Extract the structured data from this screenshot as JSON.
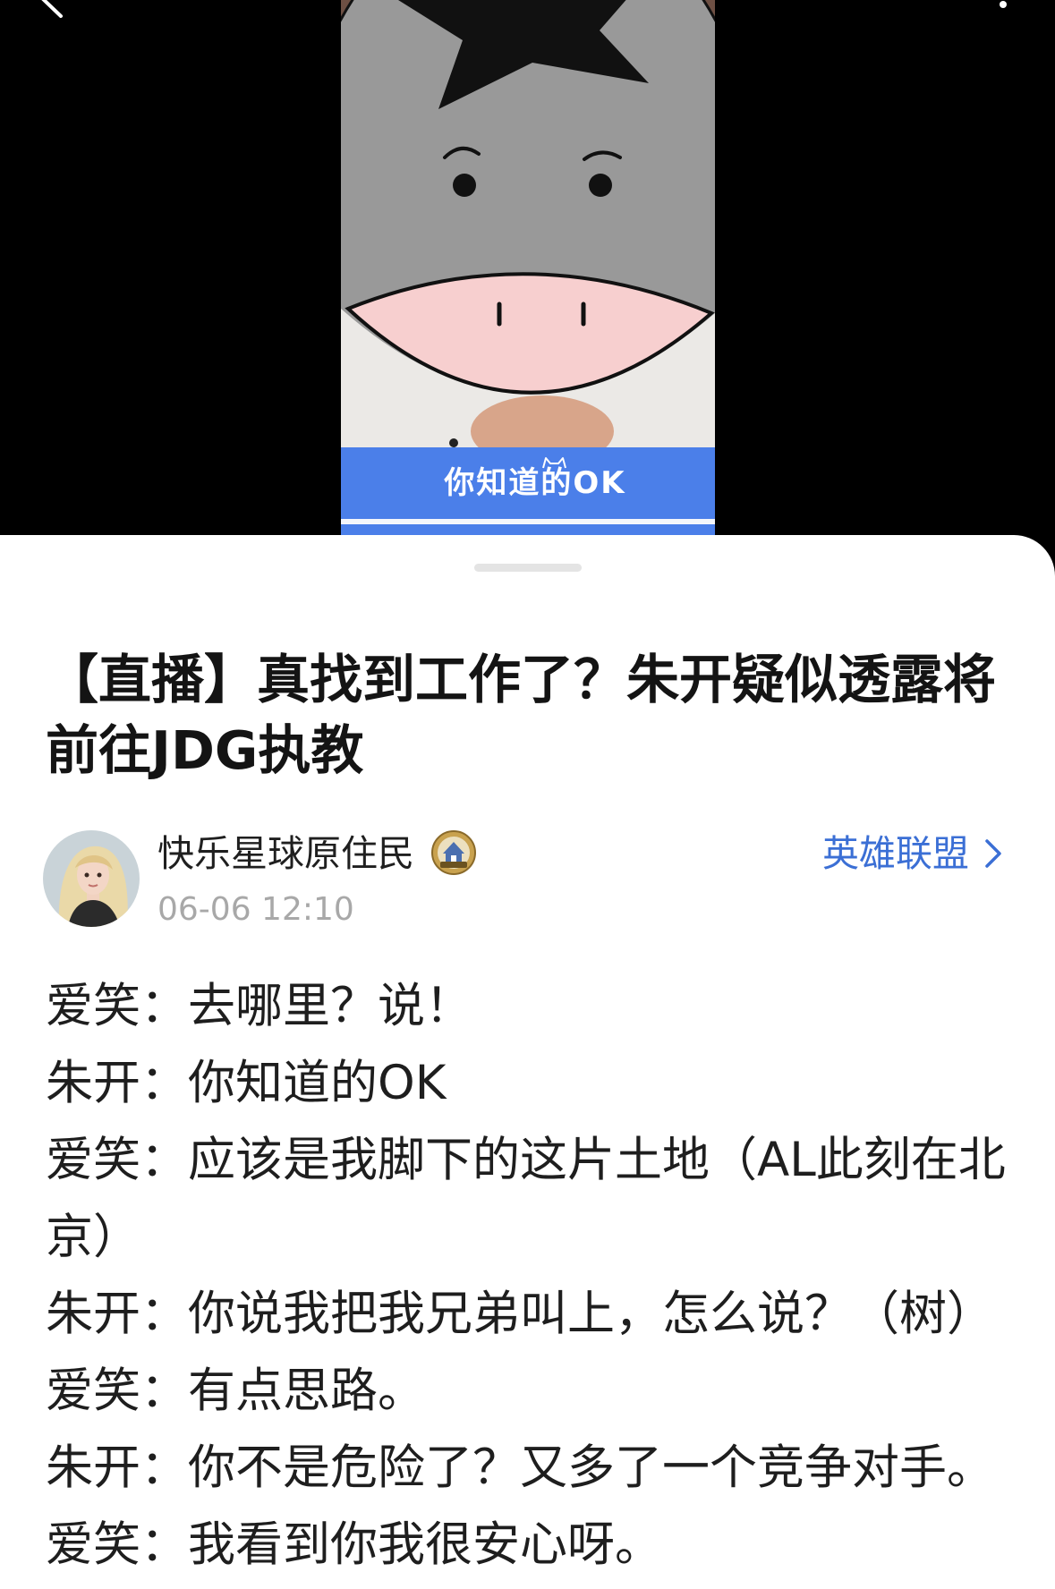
{
  "video": {
    "subtitle": "你知道的OK"
  },
  "post": {
    "title": "【直播】真找到工作了？朱开疑似透露将前往JDG执教",
    "author": {
      "name": "快乐星球原住民",
      "date": "06-06 12:10"
    },
    "category": "英雄联盟",
    "dialogue": [
      {
        "speaker": "爱笑：",
        "text": "去哪里？说！"
      },
      {
        "speaker": "朱开：",
        "text": "你知道的OK"
      },
      {
        "speaker": "爱笑：",
        "text": "应该是我脚下的这片土地（AL此刻在北京）"
      },
      {
        "speaker": "朱开：",
        "text": "你说我把我兄弟叫上，怎么说？（树）"
      },
      {
        "speaker": "爱笑：",
        "text": "有点思路。"
      },
      {
        "speaker": "朱开：",
        "text": "你不是危险了？又多了一个竞争对手。"
      },
      {
        "speaker": "爱笑：",
        "text": "我看到你我很安心呀。"
      }
    ]
  },
  "icons": {
    "back": "back-arrow-icon",
    "more": "more-options-icon",
    "category_chevron": "chevron-right-icon",
    "author_badge": "user-badge-icon"
  },
  "colors": {
    "video_background": "#000000",
    "accent": "#3b6fd5",
    "subtitle_bar": "#4b7fe9",
    "date_text": "#a8a8a8",
    "mascot_face": "#999999",
    "mascot_muzzle": "#f7cfcf"
  }
}
